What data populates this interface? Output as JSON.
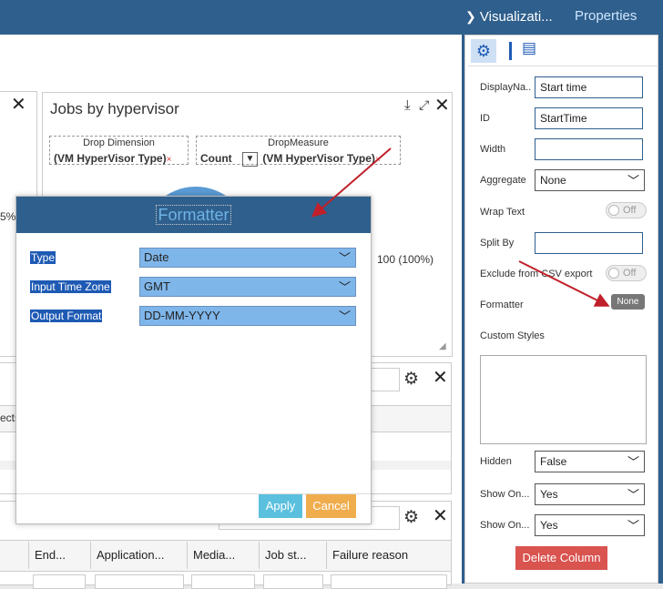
{
  "colors": {
    "header": "#2f5f8c",
    "accent_red": "#c0202a",
    "select_fill": "#7fb6ea",
    "apply": "#5bc0de",
    "cancel": "#f0ad4e",
    "delete": "#d9534f"
  },
  "left_panel": {
    "partial_text": "5%)"
  },
  "widget": {
    "title": "Jobs by hypervisor",
    "dimension_label": "Drop Dimension",
    "dimension_value": "(VM HyperVisor Type)",
    "measure_label": "DropMeasure",
    "measure_agg": "Count",
    "measure_value": "(VM HyperVisor Type)",
    "remove_mark": "×",
    "legend_value": "100 (100%)"
  },
  "grid2": {
    "partial_header": "ects"
  },
  "grid3": {
    "columns": [
      "End...",
      "Application...",
      "Media...",
      "Job st...",
      "Failure reason"
    ]
  },
  "modal": {
    "title": "Formatter",
    "fields": [
      {
        "label": "Type",
        "value": "Date"
      },
      {
        "label": "Input Time Zone",
        "value": "GMT"
      },
      {
        "label": "Output Format",
        "value": "DD-MM-YYYY"
      }
    ],
    "apply_label": "Apply",
    "cancel_label": "Cancel"
  },
  "sidebar": {
    "tab_visualization": "Visualizati...",
    "tab_properties": "Properties",
    "display_name_label": "DisplayNa...",
    "display_name_value": "Start time",
    "id_label": "ID",
    "id_value": "StartTime",
    "width_label": "Width",
    "width_value": "",
    "aggregate_label": "Aggregate",
    "aggregate_value": "None",
    "wrap_text_label": "Wrap Text",
    "wrap_text_state": "Off",
    "split_by_label": "Split By",
    "split_by_value": "",
    "exclude_csv_label": "Exclude from CSV export",
    "exclude_csv_state": "Off",
    "formatter_label": "Formatter",
    "formatter_value": "None",
    "custom_styles_label": "Custom Styles",
    "hidden_label": "Hidden",
    "hidden_value": "False",
    "show_on_1_label": "Show On...",
    "show_on_1_value": "Yes",
    "show_on_2_label": "Show On...",
    "show_on_2_value": "Yes",
    "delete_label": "Delete Column"
  },
  "icons": [
    "close-icon",
    "download-icon",
    "expand-icon",
    "gear-icon",
    "chevron-down-icon",
    "settings-gear-icon",
    "properties-list-icon",
    "chevron-right-icon"
  ]
}
